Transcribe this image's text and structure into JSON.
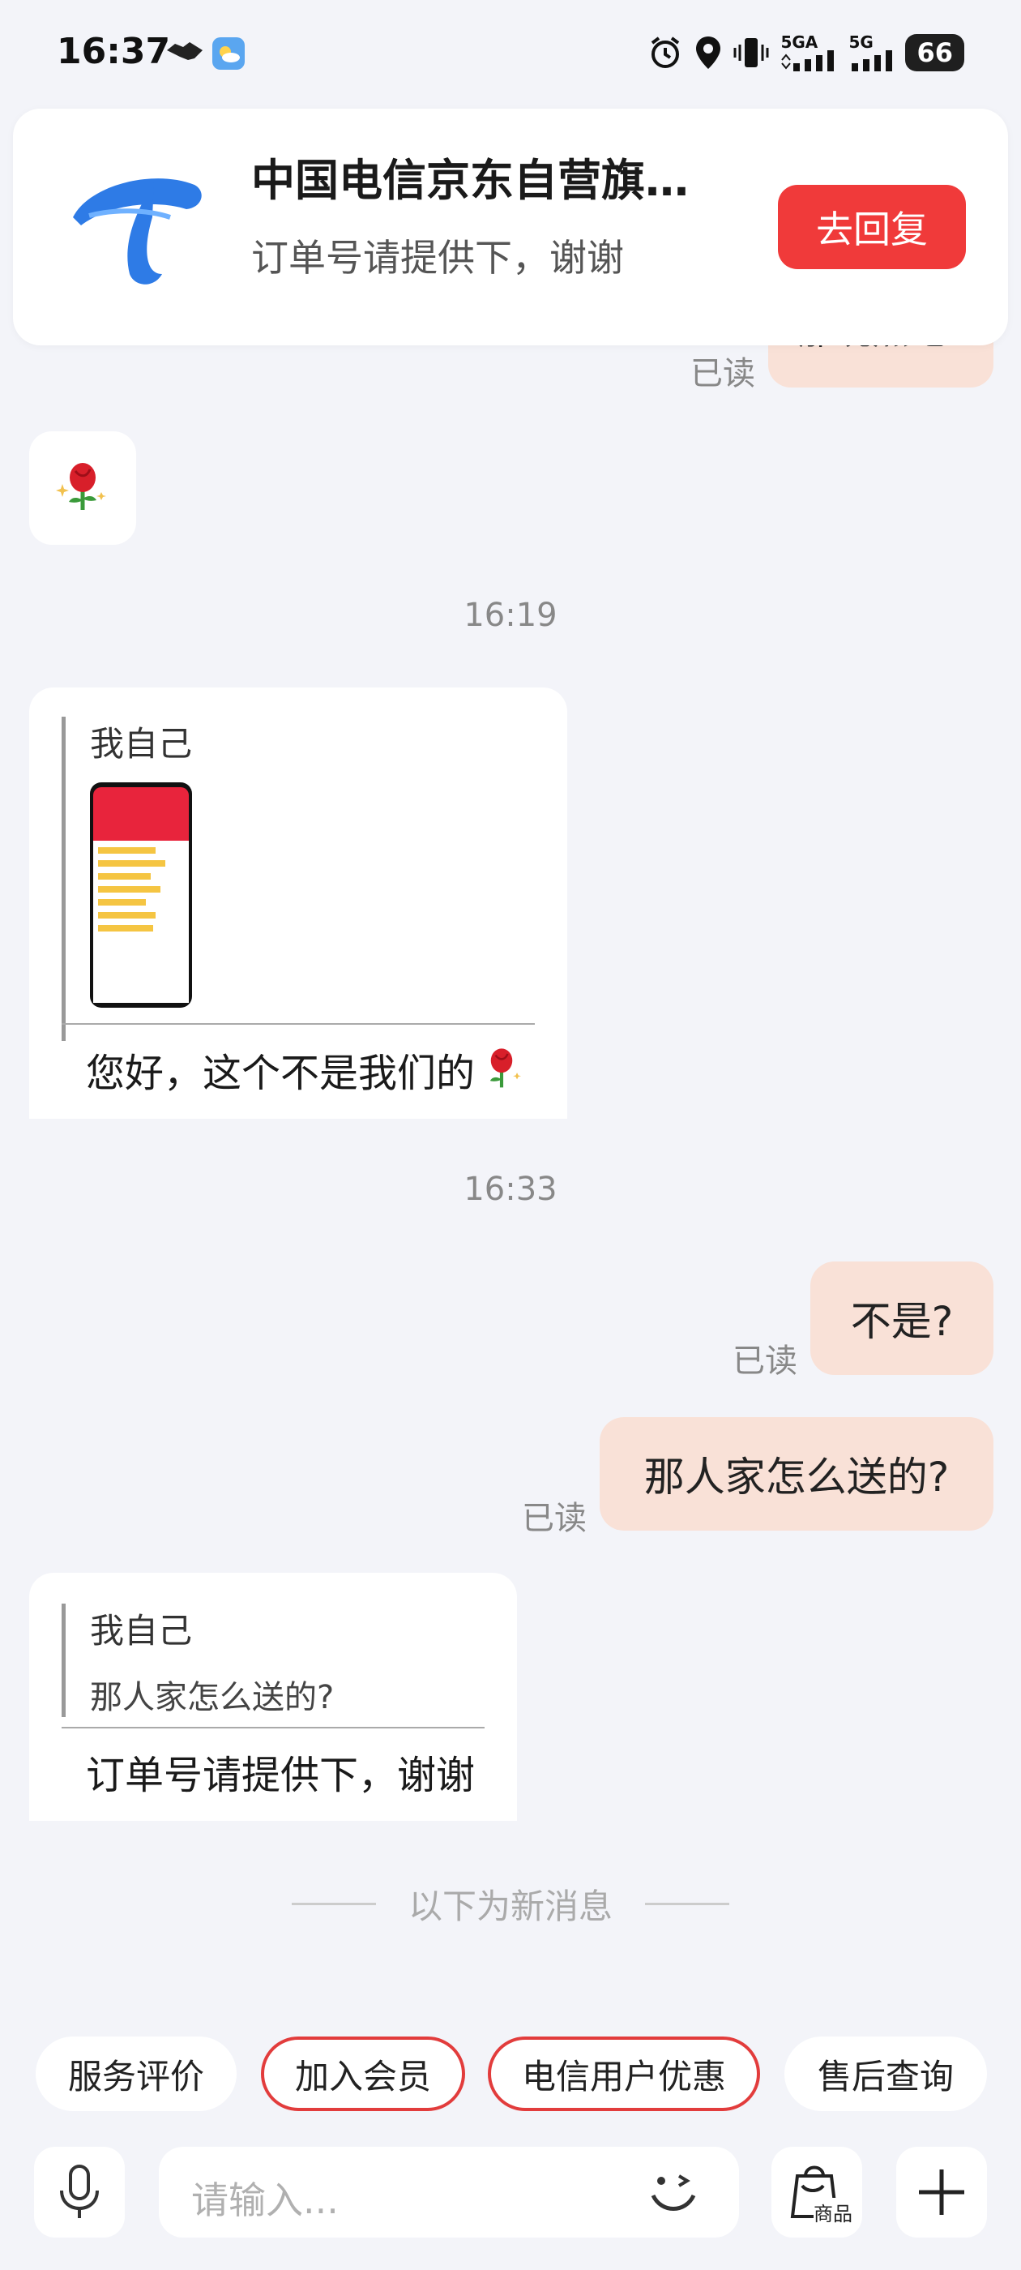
{
  "status_bar": {
    "time": "16:37",
    "signal1": "5GA",
    "signal2": "5G",
    "battery": "66"
  },
  "notification": {
    "title": "中国电信京东自营旗…",
    "message": "订单号请提供下，谢谢",
    "reply_label": "去回复"
  },
  "messages": {
    "peek_bubble_text": "那说点吧",
    "read_label": "已读",
    "timestamp_1": "16:19",
    "quote1": {
      "name": "我自己",
      "reply": "您好，这个不是我们的"
    },
    "timestamp_2": "16:33",
    "out1": "不是?",
    "out2": "那人家怎么送的?",
    "quote2": {
      "name": "我自己",
      "text": "那人家怎么送的?",
      "reply": "订单号请提供下，谢谢"
    },
    "new_messages_label": "以下为新消息"
  },
  "quick_replies": [
    "服务评价",
    "加入会员",
    "电信用户优惠",
    "售后查询"
  ],
  "input_bar": {
    "placeholder": "请输入...",
    "product_label": "商品"
  },
  "colors": {
    "accent_red": "#f03a3a",
    "outgoing_bubble": "#f9e1d7",
    "background": "#f3f4f9",
    "telecom_blue": "#2e7be6"
  }
}
